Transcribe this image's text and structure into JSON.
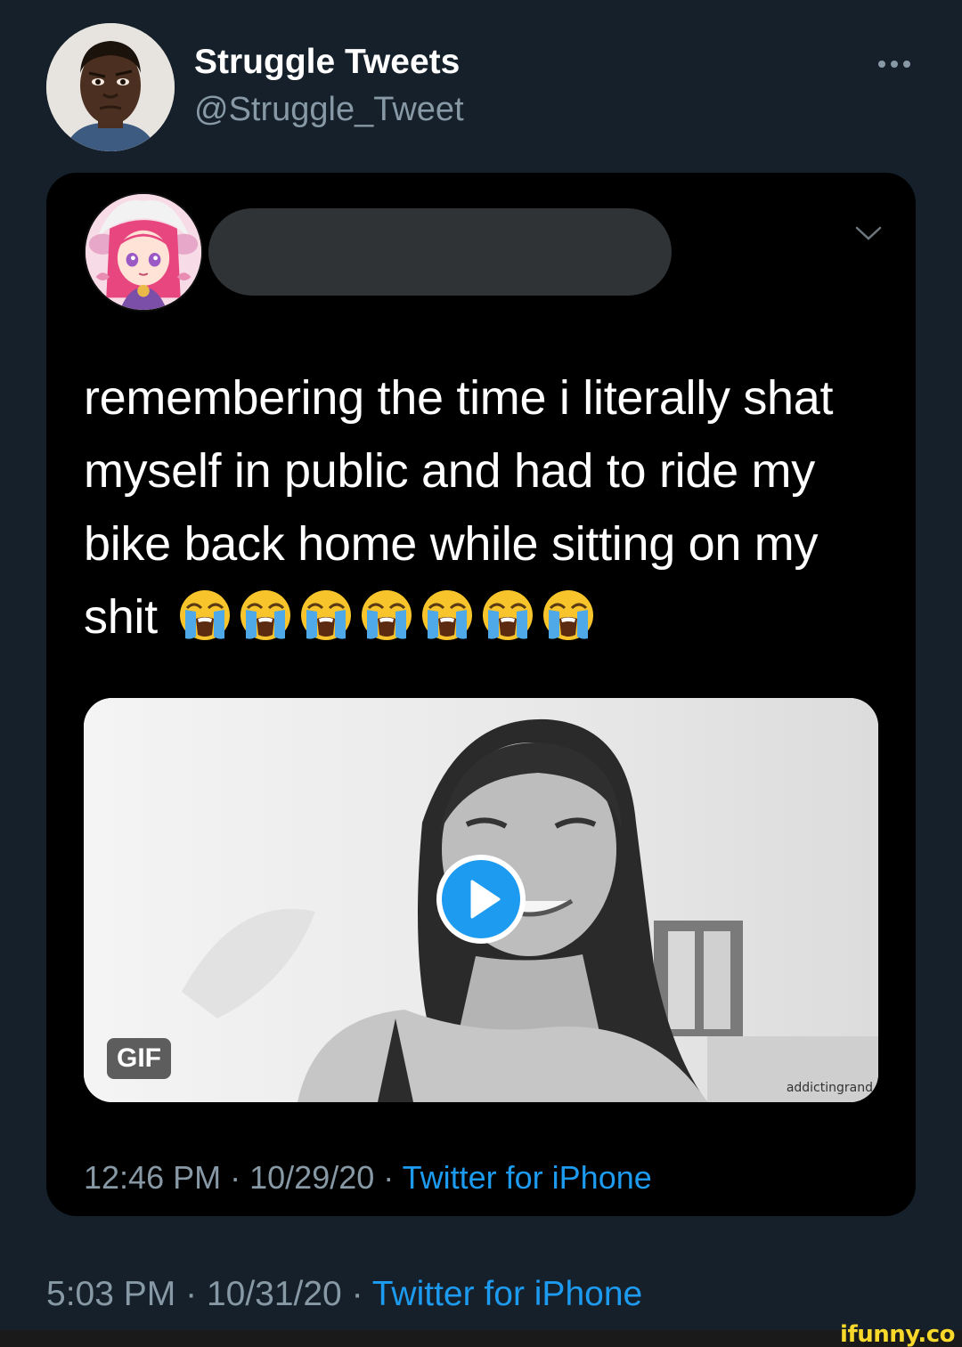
{
  "colors": {
    "background": "#15202b",
    "card": "#000000",
    "link": "#1d9bf0",
    "muted": "#8899a6"
  },
  "account": {
    "display_name": "Struggle Tweets",
    "handle": "@Struggle_Tweet",
    "avatar_icon": "man-avatar",
    "more_icon": "more-horizontal-icon"
  },
  "quoted_tweet": {
    "avatar_icon": "anime-girl-avatar",
    "name_redacted": true,
    "menu_icon": "chevron-down-icon",
    "text": "remembering the time i literally shat myself in public and had to ride my bike back home while sitting on my shit",
    "emoji_count": 7,
    "emoji_icon": "loudly-crying-face-emoji",
    "media": {
      "badge": "GIF",
      "play_icon": "play-icon",
      "watermark": "addictingrand"
    },
    "time": "12:46 PM",
    "date": "10/29/20",
    "separator": "·",
    "source": "Twitter for iPhone"
  },
  "tweet_meta": {
    "time": "5:03 PM",
    "date": "10/31/20",
    "separator": "·",
    "source": "Twitter for iPhone"
  },
  "site_watermark": "ifunny.co"
}
